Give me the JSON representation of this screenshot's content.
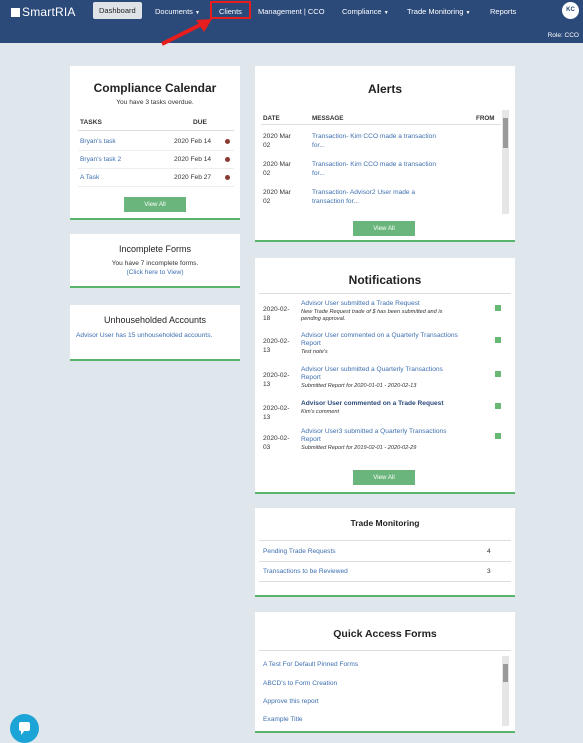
{
  "nav": {
    "logo_text": "SmartRIA",
    "dashboard": "Dashboard",
    "documents": "Documents",
    "clients": "Clients",
    "management": "Management | CCO",
    "compliance": "Compliance",
    "trade_monitoring": "Trade Monitoring",
    "reports": "Reports",
    "avatar_initials": "KC",
    "role": "Role: CCO"
  },
  "calendar": {
    "title": "Compliance Calendar",
    "subtitle": "You have 3 tasks overdue.",
    "col_tasks": "TASKS",
    "col_due": "DUE",
    "rows": [
      {
        "task": "Bryan's task",
        "due": "2020 Feb 14"
      },
      {
        "task": "Bryan's task 2",
        "due": "2020 Feb 14"
      },
      {
        "task": "A Task",
        "due": "2020 Feb 27"
      }
    ],
    "view_all": "View All"
  },
  "incomplete": {
    "title": "Incomplete Forms",
    "line1": "You have 7 incomplete forms.",
    "line2": "(Click here to View)"
  },
  "unhouseholded": {
    "title": "Unhouseholded Accounts",
    "text": "Advisor User has 15 unhouseholded accounts."
  },
  "alerts": {
    "title": "Alerts",
    "col_date": "DATE",
    "col_message": "MESSAGE",
    "col_from": "FROM",
    "rows": [
      {
        "date1": "2020 Mar",
        "date2": "02",
        "msg1": "Transaction- Kim CCO made a transaction",
        "msg2": "for..."
      },
      {
        "date1": "2020 Mar",
        "date2": "02",
        "msg1": "Transaction- Kim CCO made a transaction",
        "msg2": "for..."
      },
      {
        "date1": "2020 Mar",
        "date2": "02",
        "msg1": "Transaction- Advisor2 User made a",
        "msg2": "transaction for..."
      }
    ],
    "view_all": "View All"
  },
  "notifications": {
    "title": "Notifications",
    "rows": [
      {
        "date1": "2020-02-",
        "date2": "18",
        "title1": "Advisor User submitted a Trade Request",
        "title2": "",
        "sub1": "New Trade Request trade of $ has been submitted and is",
        "sub2": "pending approval."
      },
      {
        "date1": "2020-02-",
        "date2": "13",
        "title1": "Advisor User commented on a Quarterly Transactions",
        "title2": "Report",
        "sub1": "Test note's",
        "sub2": ""
      },
      {
        "date1": "2020-02-",
        "date2": "13",
        "title1": "Advisor User submitted a Quarterly Transactions",
        "title2": "Report",
        "sub1": "Submitted Report for 2020-01-01 - 2020-02-13",
        "sub2": ""
      },
      {
        "date1": "2020-02-",
        "date2": "13",
        "title1": "Advisor User commented on a Trade Request",
        "title2": "",
        "sub1": "Kim's comment",
        "sub2": ""
      },
      {
        "date1": "2020-02-",
        "date2": "03",
        "title1": "Advisor User3 submitted a Quarterly Transactions",
        "title2": "Report",
        "sub1": "Submitted Report for 2019-02-01 - 2020-02-29",
        "sub2": ""
      }
    ],
    "view_all": "View All"
  },
  "trade_monitoring": {
    "title": "Trade Monitoring",
    "rows": [
      {
        "label": "Pending Trade Requests",
        "count": "4"
      },
      {
        "label": "Transactions to be Reviewed",
        "count": "3"
      }
    ]
  },
  "quick_access": {
    "title": "Quick Access Forms",
    "items": [
      "A Test For Default Pinned Forms",
      "ABCD's to Form Creation",
      "Approve this report",
      "Example Title"
    ]
  }
}
